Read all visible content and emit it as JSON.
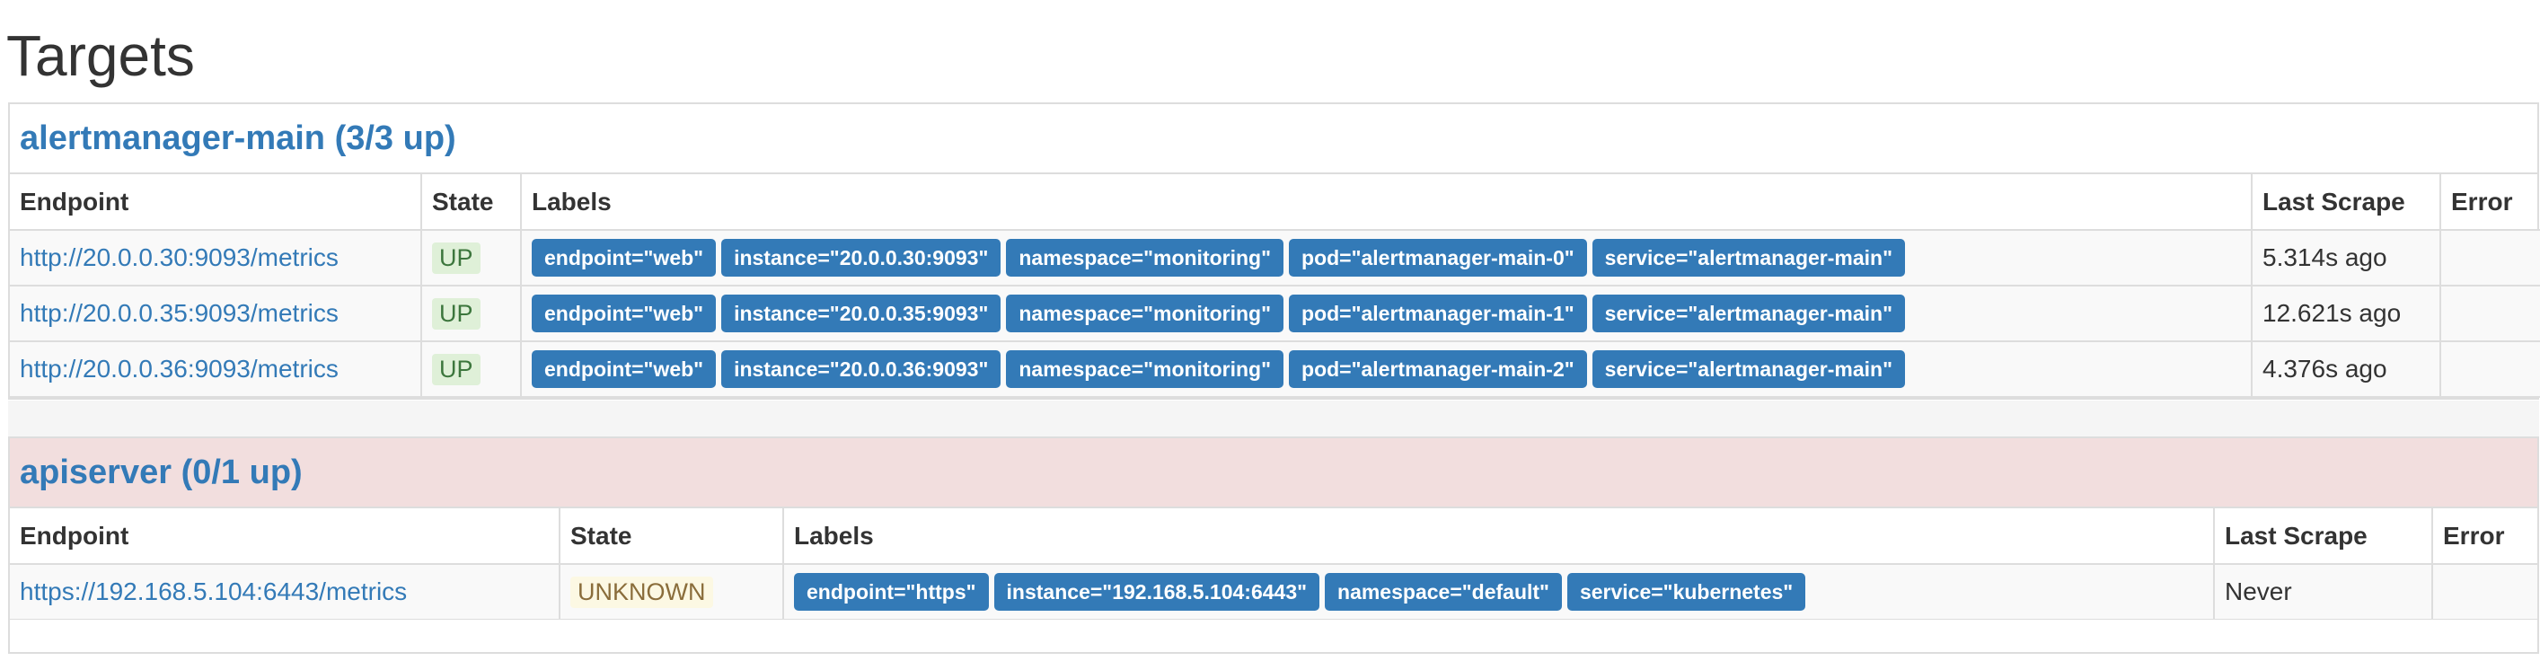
{
  "page": {
    "title": "Targets"
  },
  "jobs": [
    {
      "title": "alertmanager-main (3/3 up)",
      "status": "ok",
      "columns": {
        "endpoint": "Endpoint",
        "state": "State",
        "labels": "Labels",
        "last_scrape": "Last Scrape",
        "error": "Error"
      },
      "rows": [
        {
          "endpoint": "http://20.0.0.30:9093/metrics",
          "state": "UP",
          "labels": [
            "endpoint=\"web\"",
            "instance=\"20.0.0.30:9093\"",
            "namespace=\"monitoring\"",
            "pod=\"alertmanager-main-0\"",
            "service=\"alertmanager-main\""
          ],
          "last_scrape": "5.314s ago",
          "error": ""
        },
        {
          "endpoint": "http://20.0.0.35:9093/metrics",
          "state": "UP",
          "labels": [
            "endpoint=\"web\"",
            "instance=\"20.0.0.35:9093\"",
            "namespace=\"monitoring\"",
            "pod=\"alertmanager-main-1\"",
            "service=\"alertmanager-main\""
          ],
          "last_scrape": "12.621s ago",
          "error": ""
        },
        {
          "endpoint": "http://20.0.0.36:9093/metrics",
          "state": "UP",
          "labels": [
            "endpoint=\"web\"",
            "instance=\"20.0.0.36:9093\"",
            "namespace=\"monitoring\"",
            "pod=\"alertmanager-main-2\"",
            "service=\"alertmanager-main\""
          ],
          "last_scrape": "4.376s ago",
          "error": ""
        }
      ]
    },
    {
      "title": "apiserver (0/1 up)",
      "status": "bad",
      "columns": {
        "endpoint": "Endpoint",
        "state": "State",
        "labels": "Labels",
        "last_scrape": "Last Scrape",
        "error": "Error"
      },
      "rows": [
        {
          "endpoint": "https://192.168.5.104:6443/metrics",
          "state": "UNKNOWN",
          "labels": [
            "endpoint=\"https\"",
            "instance=\"192.168.5.104:6443\"",
            "namespace=\"default\"",
            "service=\"kubernetes\""
          ],
          "last_scrape": "Never",
          "error": ""
        }
      ]
    }
  ],
  "colors": {
    "link": "#337ab7",
    "label_badge_bg": "#337ab7",
    "state_up_bg": "#dff0d8",
    "state_up_text": "#3c763d",
    "state_unknown_bg": "#fcf8e3",
    "state_unknown_text": "#8a6d3b",
    "job_bad_bg": "#f2dede"
  }
}
